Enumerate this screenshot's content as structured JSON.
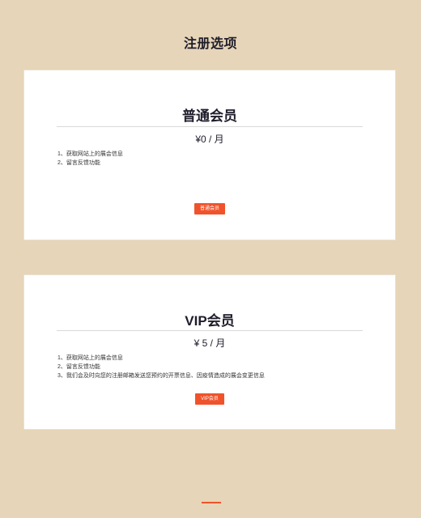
{
  "page": {
    "title": "注册选项"
  },
  "plans": [
    {
      "name": "普通会员",
      "price": "¥0 / 月",
      "features": [
        "1、获取网站上的展会信息",
        "2、留言反馈功能"
      ],
      "button_label": "普通会员"
    },
    {
      "name": "VIP会员",
      "price": "¥ 5 / 月",
      "features": [
        "1、获取网站上的展会信息",
        "2、留言反馈功能",
        "3、我们会及时向您的注册邮箱发送您预约的开票信息、因疫情造成的展会变更信息"
      ],
      "button_label": "VIP会员"
    }
  ],
  "colors": {
    "background": "#e6d5b8",
    "accent": "#f0532b",
    "card": "#ffffff"
  }
}
